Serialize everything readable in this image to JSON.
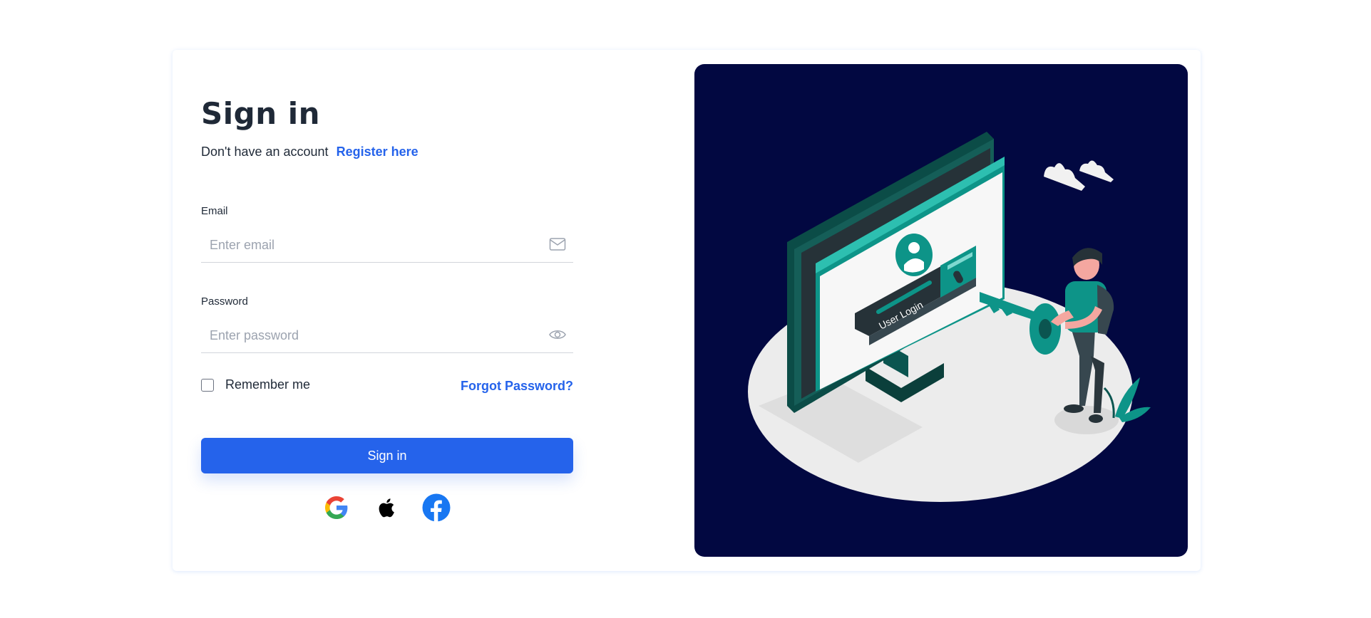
{
  "signin": {
    "title": "Sign in",
    "no_account_text": "Don't have an account",
    "register_link": "Register here",
    "email": {
      "label": "Email",
      "placeholder": "Enter email",
      "value": ""
    },
    "password": {
      "label": "Password",
      "placeholder": "Enter password",
      "value": ""
    },
    "remember_label": "Remember me",
    "remember_checked": false,
    "forgot_link": "Forgot Password?",
    "submit_label": "Sign in"
  },
  "social": [
    {
      "name": "google-icon"
    },
    {
      "name": "apple-icon"
    },
    {
      "name": "facebook-icon"
    }
  ],
  "illustration": {
    "screen_text": "User Login",
    "background_color": "#020841",
    "accent_color": "#0d9488"
  },
  "colors": {
    "primary": "#2563eb",
    "text": "#1f2937",
    "placeholder": "#9ca3af"
  }
}
